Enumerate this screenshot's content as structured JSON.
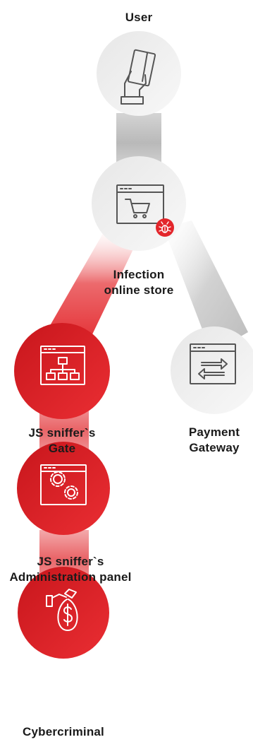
{
  "nodes": {
    "user": {
      "label": "User",
      "icon": "card-in-hand-icon"
    },
    "store": {
      "label_line1": "Infection",
      "label_line2": "online store",
      "icon": "browser-cart-icon",
      "badge_icon": "bug-icon"
    },
    "gate": {
      "label_line1": "JS sniffer`s",
      "label_line2": "Gate",
      "icon": "browser-hierarchy-icon"
    },
    "gateway": {
      "label_line1": "Payment",
      "label_line2": "Gateway",
      "icon": "browser-transfer-icon"
    },
    "admin": {
      "label_line1": "JS sniffer`s",
      "label_line2": "Administration panel",
      "icon": "browser-gears-icon"
    },
    "criminal": {
      "label": "Cybercriminal",
      "icon": "money-bag-icon"
    }
  },
  "colors": {
    "red": "#e3262b",
    "red_dark": "#c8161c",
    "gray_node": "#f0f0f0",
    "gray_connector": "#c9c9c9",
    "icon_gray": "#555555",
    "text": "#1a1a1a"
  }
}
